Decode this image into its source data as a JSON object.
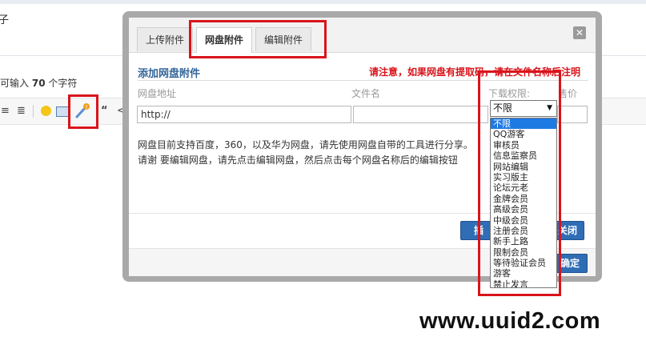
{
  "background": {
    "top_glyph": "子",
    "char_count": {
      "prefix": "可输入",
      "number": "70",
      "suffix": "个字符"
    },
    "toolbar_icons": [
      "align-left-icon",
      "align-right-icon",
      "emoji-icon",
      "image-icon",
      "netdisk-link-icon",
      "quote-icon",
      "code-icon"
    ],
    "quote_glyph": "“",
    "code_glyph": "<>"
  },
  "dialog": {
    "tabs": [
      {
        "label": "上传附件"
      },
      {
        "label": "网盘附件"
      },
      {
        "label": "编辑附件"
      }
    ],
    "active_tab": "网盘附件",
    "close_glyph": "✕",
    "heading": "添加网盘附件",
    "notice": "请注意，如果网盘有提取码，请在文件名称后注明",
    "columns": {
      "address": "网盘地址",
      "filename": "文件名",
      "permission": "下载权限:",
      "price": "售价"
    },
    "address_value": "http://",
    "description": "网盘目前支持百度，360，以及华为网盘，请先使用网盘自带的工具进行分享。请谢 要编辑网盘，请先点击编辑网盘，然后点击每个网盘名称后的编辑按钮",
    "buttons": {
      "insert": "插",
      "close": "关闭",
      "confirm": "确定"
    },
    "permission_select": {
      "selected": "不限",
      "arrow": "▼",
      "options": [
        "不限",
        "QQ游客",
        "审核员",
        "信息监察员",
        "网站编辑",
        "实习版主",
        "论坛元老",
        "金牌会员",
        "高级会员",
        "中级会员",
        "注册会员",
        "新手上路",
        "限制会员",
        "等待验证会员",
        "游客",
        "禁止发言"
      ]
    }
  },
  "watermark": "www.uuid2.com",
  "colors": {
    "accent": "#2f6db5",
    "highlight": "#d9141b",
    "selected_option": "#1e7ae3"
  }
}
